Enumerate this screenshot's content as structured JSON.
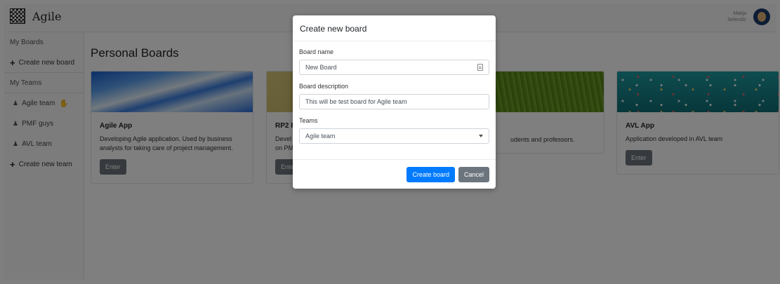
{
  "navbar": {
    "brand": "Agile",
    "user_first": "Matija",
    "user_last": "Selendic"
  },
  "sidebar": {
    "my_boards": "My Boards",
    "create_board": "Create new board",
    "my_teams": "My Teams",
    "teams": [
      {
        "label": "Agile team",
        "icon": "hand-icon"
      },
      {
        "label": "PMF guys"
      },
      {
        "label": "AVL team"
      }
    ],
    "create_team": "Create new team"
  },
  "main": {
    "title": "Personal Boards",
    "cards": [
      {
        "title": "Agile App",
        "text": "Developing Agile application. Used by business analysts for taking care of project management.",
        "button": "Enter"
      },
      {
        "title": "RP2 P",
        "text": "Devel on PM",
        "button": "Ente"
      },
      {
        "title": "",
        "text": "udents and professors.",
        "button": ""
      },
      {
        "title": "AVL App",
        "text": "Application developed in AVL team",
        "button": "Enter"
      }
    ]
  },
  "modal": {
    "title": "Create new board",
    "board_name_label": "Board name",
    "board_name_value": "New Board",
    "board_desc_label": "Board description",
    "board_desc_value": "This will be test board for Agile team",
    "teams_label": "Teams",
    "teams_value": "Agile team",
    "create_button": "Create board",
    "cancel_button": "Cancel"
  },
  "colors": {
    "primary": "#007bff",
    "secondary": "#6c757d",
    "overlay": "rgba(0,0,0,0.5)"
  }
}
